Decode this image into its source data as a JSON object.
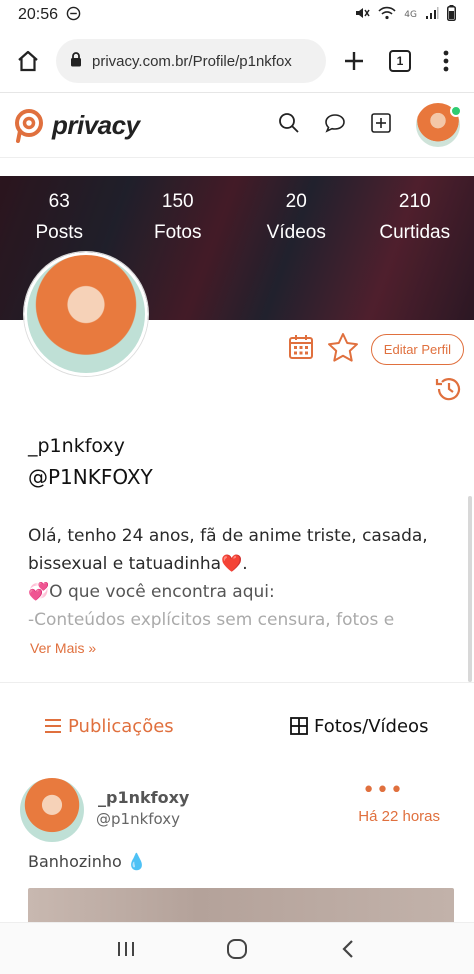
{
  "statusbar": {
    "time": "20:56",
    "network": "4G"
  },
  "browser": {
    "url": "privacy.com.br/Profile/p1nkfox",
    "tab_count": "1"
  },
  "app": {
    "logo_text": "privacy",
    "accent": "#e0703e"
  },
  "stats": [
    {
      "value": "63",
      "label": "Posts"
    },
    {
      "value": "150",
      "label": "Fotos"
    },
    {
      "value": "20",
      "label": "Vídeos"
    },
    {
      "value": "210",
      "label": "Curtidas"
    }
  ],
  "profile": {
    "edit_label": "Editar Perfil",
    "display_name": "_p1nkfoxy",
    "handle": "@P1NKFOXY",
    "bio_line1": "Olá, tenho 24 anos, fã de anime triste, casada,",
    "bio_line2": "bissexual e tatuadinha❤️.",
    "bio_line3": "💞O que você encontra aqui:",
    "bio_line4": "-Conteúdos explícitos sem censura, fotos e",
    "more_label": "Ver Mais »"
  },
  "tabs": {
    "publications": "Publicações",
    "media": "Fotos/Vídeos"
  },
  "post": {
    "name": "_p1nkfoxy",
    "handle": "@p1nkfoxy",
    "menu": "•••",
    "time": "Há 22 horas",
    "caption": "Banhozinho 💧"
  }
}
